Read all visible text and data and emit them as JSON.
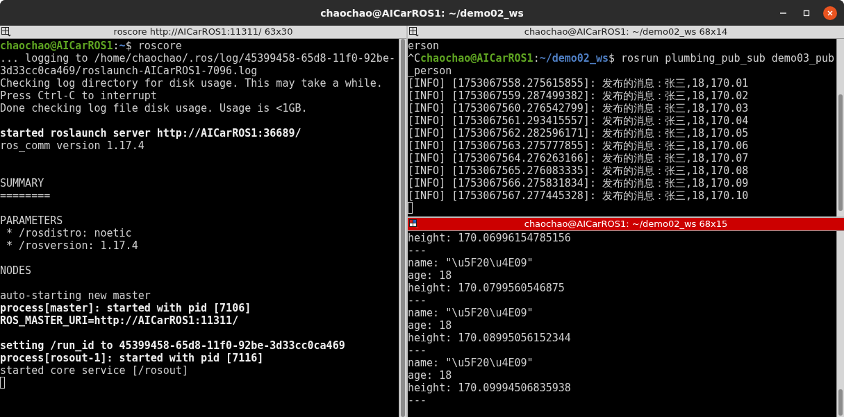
{
  "window": {
    "title": "chaochao@AICarROS1: ~/demo02_ws"
  },
  "panes": [
    {
      "title": "roscore http://AICarROS1:11311/ 63x30",
      "focused": false,
      "lines": [
        {
          "kind": "prompt",
          "user": "chaochao@AICarROS1",
          "colon": ":",
          "path": "~",
          "command": "$ roscore"
        },
        {
          "kind": "plain",
          "text": "... logging to /home/chaochao/.ros/log/45399458-65d8-11f0-92be-"
        },
        {
          "kind": "plain",
          "text": "3d33cc0ca469/roslaunch-AICarROS1-7096.log"
        },
        {
          "kind": "plain",
          "text": "Checking log directory for disk usage. This may take a while."
        },
        {
          "kind": "plain",
          "text": "Press Ctrl-C to interrupt"
        },
        {
          "kind": "plain",
          "text": "Done checking log file disk usage. Usage is <1GB."
        },
        {
          "kind": "blank"
        },
        {
          "kind": "bold",
          "text": "started roslaunch server http://AICarROS1:36689/"
        },
        {
          "kind": "plain",
          "text": "ros_comm version 1.17.4"
        },
        {
          "kind": "blank"
        },
        {
          "kind": "blank"
        },
        {
          "kind": "plain",
          "text": "SUMMARY"
        },
        {
          "kind": "plain",
          "text": "========"
        },
        {
          "kind": "blank"
        },
        {
          "kind": "plain",
          "text": "PARAMETERS"
        },
        {
          "kind": "plain",
          "text": " * /rosdistro: noetic"
        },
        {
          "kind": "plain",
          "text": " * /rosversion: 1.17.4"
        },
        {
          "kind": "blank"
        },
        {
          "kind": "plain",
          "text": "NODES"
        },
        {
          "kind": "blank"
        },
        {
          "kind": "plain",
          "text": "auto-starting new master"
        },
        {
          "kind": "bold",
          "text": "process[master]: started with pid [7106]"
        },
        {
          "kind": "bold",
          "text": "ROS_MASTER_URI=http://AICarROS1:11311/"
        },
        {
          "kind": "blank"
        },
        {
          "kind": "bold",
          "text": "setting /run_id to 45399458-65d8-11f0-92be-3d33cc0ca469"
        },
        {
          "kind": "bold",
          "text": "process[rosout-1]: started with pid [7116]"
        },
        {
          "kind": "plain",
          "text": "started core service [/rosout]"
        },
        {
          "kind": "cursor"
        }
      ]
    },
    {
      "title": "chaochao@AICarROS1: ~/demo02_ws 68x14",
      "focused": false,
      "lines": [
        {
          "kind": "plain",
          "text": "erson"
        },
        {
          "kind": "prompt",
          "prefix": "^C",
          "user": "chaochao@AICarROS1",
          "colon": ":",
          "path": "~/demo02_ws",
          "command": "$ rosrun plumbing_pub_sub demo03_pub"
        },
        {
          "kind": "plain",
          "text": "_person"
        },
        {
          "kind": "plain",
          "text": "[INFO] [1753067558.275615855]: 发布的消息：张三,18,170.01"
        },
        {
          "kind": "plain",
          "text": "[INFO] [1753067559.287499382]: 发布的消息：张三,18,170.02"
        },
        {
          "kind": "plain",
          "text": "[INFO] [1753067560.276542799]: 发布的消息：张三,18,170.03"
        },
        {
          "kind": "plain",
          "text": "[INFO] [1753067561.293415557]: 发布的消息：张三,18,170.04"
        },
        {
          "kind": "plain",
          "text": "[INFO] [1753067562.282596171]: 发布的消息：张三,18,170.05"
        },
        {
          "kind": "plain",
          "text": "[INFO] [1753067563.275777855]: 发布的消息：张三,18,170.06"
        },
        {
          "kind": "plain",
          "text": "[INFO] [1753067564.276263166]: 发布的消息：张三,18,170.07"
        },
        {
          "kind": "plain",
          "text": "[INFO] [1753067565.276083335]: 发布的消息：张三,18,170.08"
        },
        {
          "kind": "plain",
          "text": "[INFO] [1753067566.275831834]: 发布的消息：张三,18,170.09"
        },
        {
          "kind": "plain",
          "text": "[INFO] [1753067567.277445328]: 发布的消息：张三,18,170.10"
        },
        {
          "kind": "cursor"
        }
      ]
    },
    {
      "title": "chaochao@AICarROS1: ~/demo02_ws 68x15",
      "focused": true,
      "lines": [
        {
          "kind": "plain",
          "text": "height: 170.06996154785156"
        },
        {
          "kind": "plain",
          "text": "---"
        },
        {
          "kind": "plain",
          "text": "name: \"\\u5F20\\u4E09\""
        },
        {
          "kind": "plain",
          "text": "age: 18"
        },
        {
          "kind": "plain",
          "text": "height: 170.0799560546875"
        },
        {
          "kind": "plain",
          "text": "---"
        },
        {
          "kind": "plain",
          "text": "name: \"\\u5F20\\u4E09\""
        },
        {
          "kind": "plain",
          "text": "age: 18"
        },
        {
          "kind": "plain",
          "text": "height: 170.08995056152344"
        },
        {
          "kind": "plain",
          "text": "---"
        },
        {
          "kind": "plain",
          "text": "name: \"\\u5F20\\u4E09\""
        },
        {
          "kind": "plain",
          "text": "age: 18"
        },
        {
          "kind": "plain",
          "text": "height: 170.09994506835938"
        },
        {
          "kind": "plain",
          "text": "---"
        }
      ]
    }
  ]
}
